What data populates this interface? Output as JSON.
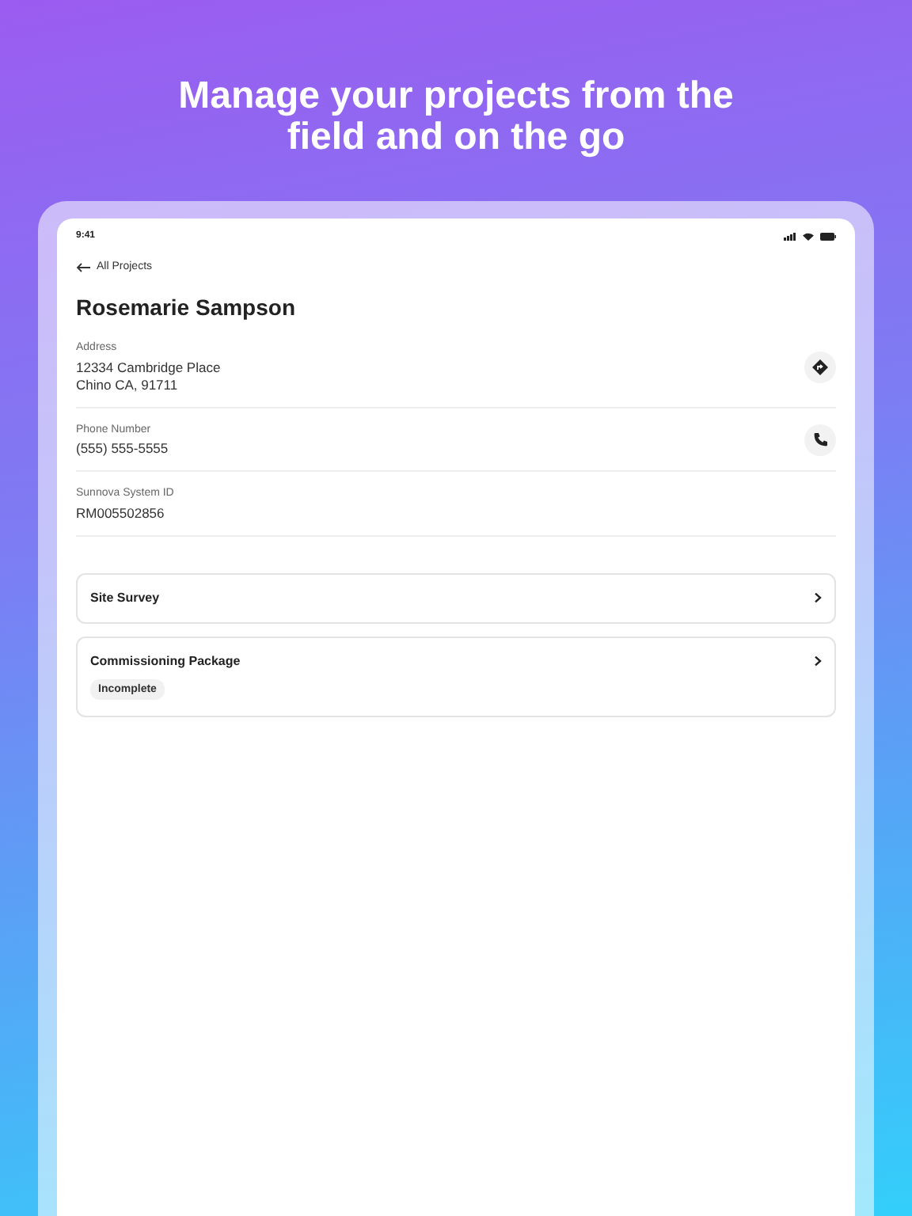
{
  "headline": "Manage your projects from the field and on the go",
  "status_bar": {
    "time": "9:41"
  },
  "back_link": {
    "label": "All Projects"
  },
  "title": "Rosemarie Sampson",
  "fields": [
    {
      "label": "Address",
      "lines": [
        "12334 Cambridge Place",
        "Chino CA, 91711"
      ],
      "kind": "directions"
    },
    {
      "label": "Phone Number",
      "lines": [
        "(555) 555-5555"
      ],
      "kind": "call"
    },
    {
      "label": "Sunnova System ID",
      "lines": [
        "RM005502856"
      ],
      "kind": "plain"
    }
  ],
  "cards": [
    {
      "title": "Site Survey"
    },
    {
      "title": "Commissioning Package",
      "status": "Incomplete"
    }
  ]
}
